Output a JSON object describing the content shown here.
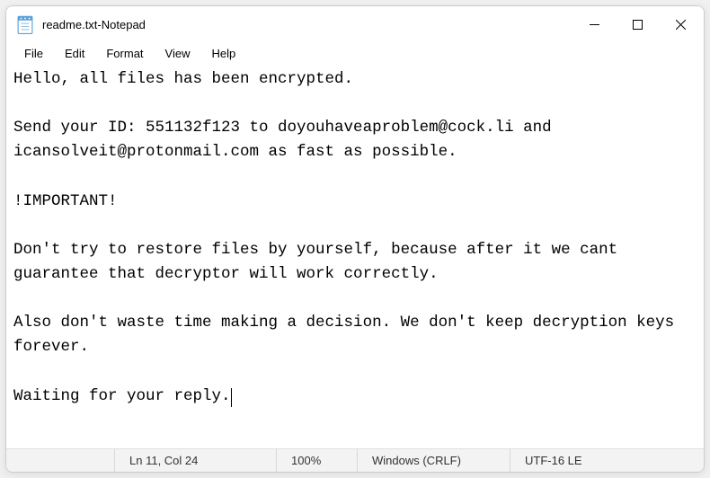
{
  "titlebar": {
    "filename": "readme.txt",
    "app": "Notepad",
    "separator": " - "
  },
  "menubar": {
    "items": [
      "File",
      "Edit",
      "Format",
      "View",
      "Help"
    ]
  },
  "editor": {
    "content": "Hello, all files has been encrypted.\n\nSend your ID: 551132f123 to doyouhaveaproblem@cock.li and icansolveit@protonmail.com as fast as possible.\n\n!IMPORTANT!\n\nDon't try to restore files by yourself, because after it we cant guarantee that decryptor will work correctly.\n\nAlso don't waste time making a decision. We don't keep decryption keys forever.\n\nWaiting for your reply."
  },
  "statusbar": {
    "position": "Ln 11, Col 24",
    "zoom": "100%",
    "eol": "Windows (CRLF)",
    "encoding": "UTF-16 LE"
  },
  "icons": {
    "notepad": "notepad-icon",
    "minimize": "minimize-icon",
    "maximize": "maximize-icon",
    "close": "close-icon"
  }
}
